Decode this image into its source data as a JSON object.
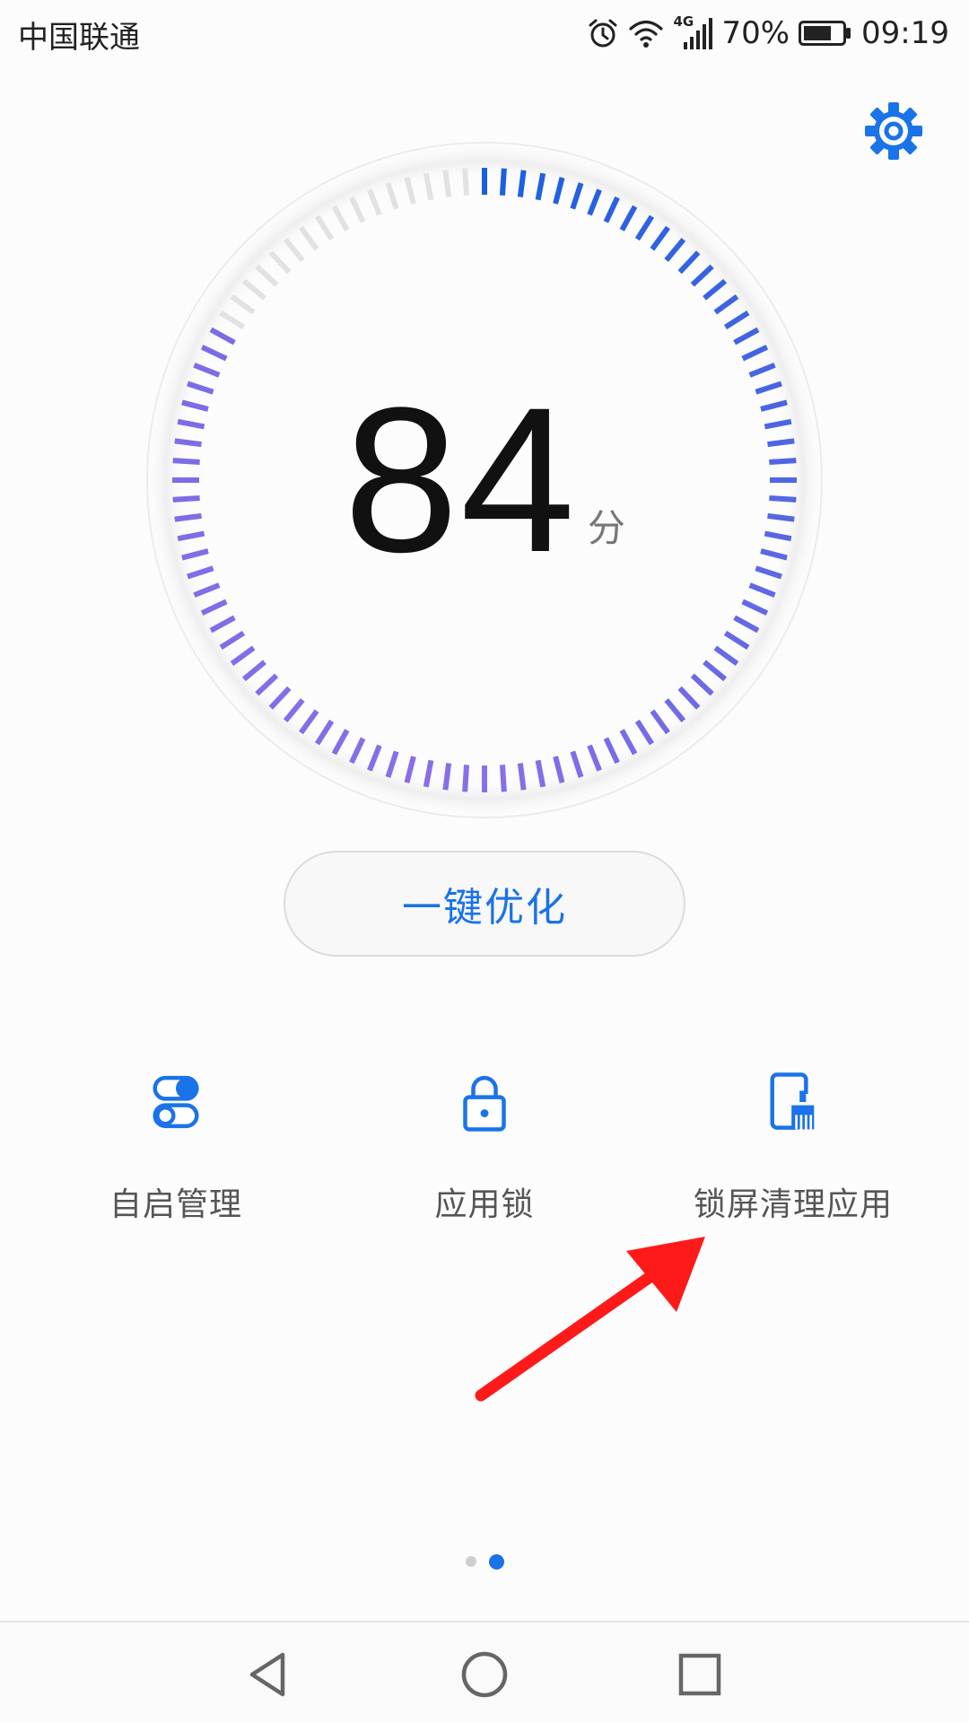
{
  "status_bar": {
    "carrier": "中国联通",
    "network": "4G",
    "battery": "70%",
    "time": "09:19"
  },
  "dial": {
    "score": "84",
    "unit": "分",
    "fill_fraction": 0.84,
    "colors": {
      "start": "#1a5fe0",
      "end": "#8a6ee8",
      "inactive": "#e2e2e2"
    }
  },
  "optimize_button": {
    "label": "一键优化"
  },
  "features": [
    {
      "label": "自启管理",
      "icon": "toggle-switch-icon"
    },
    {
      "label": "应用锁",
      "icon": "padlock-icon"
    },
    {
      "label": "锁屏清理应用",
      "icon": "phone-broom-icon"
    }
  ],
  "page_indicator": {
    "count": 2,
    "active": 2
  },
  "colors": {
    "accent": "#1a73e8",
    "annotation": "#ff1a1a"
  }
}
